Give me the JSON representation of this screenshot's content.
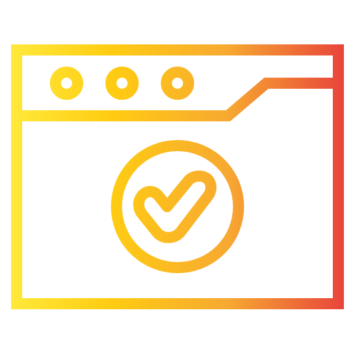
{
  "icon": {
    "name": "browser-window-checkmark-icon",
    "window_controls": [
      "control-dot",
      "control-dot",
      "control-dot"
    ],
    "badge": "checkmark"
  },
  "colors": {
    "gradient_start": "#FFE93A",
    "gradient_mid": "#FFCC12",
    "gradient_mid2": "#F7A931",
    "gradient_end": "#E8443B",
    "background": "#FFFFFF"
  }
}
